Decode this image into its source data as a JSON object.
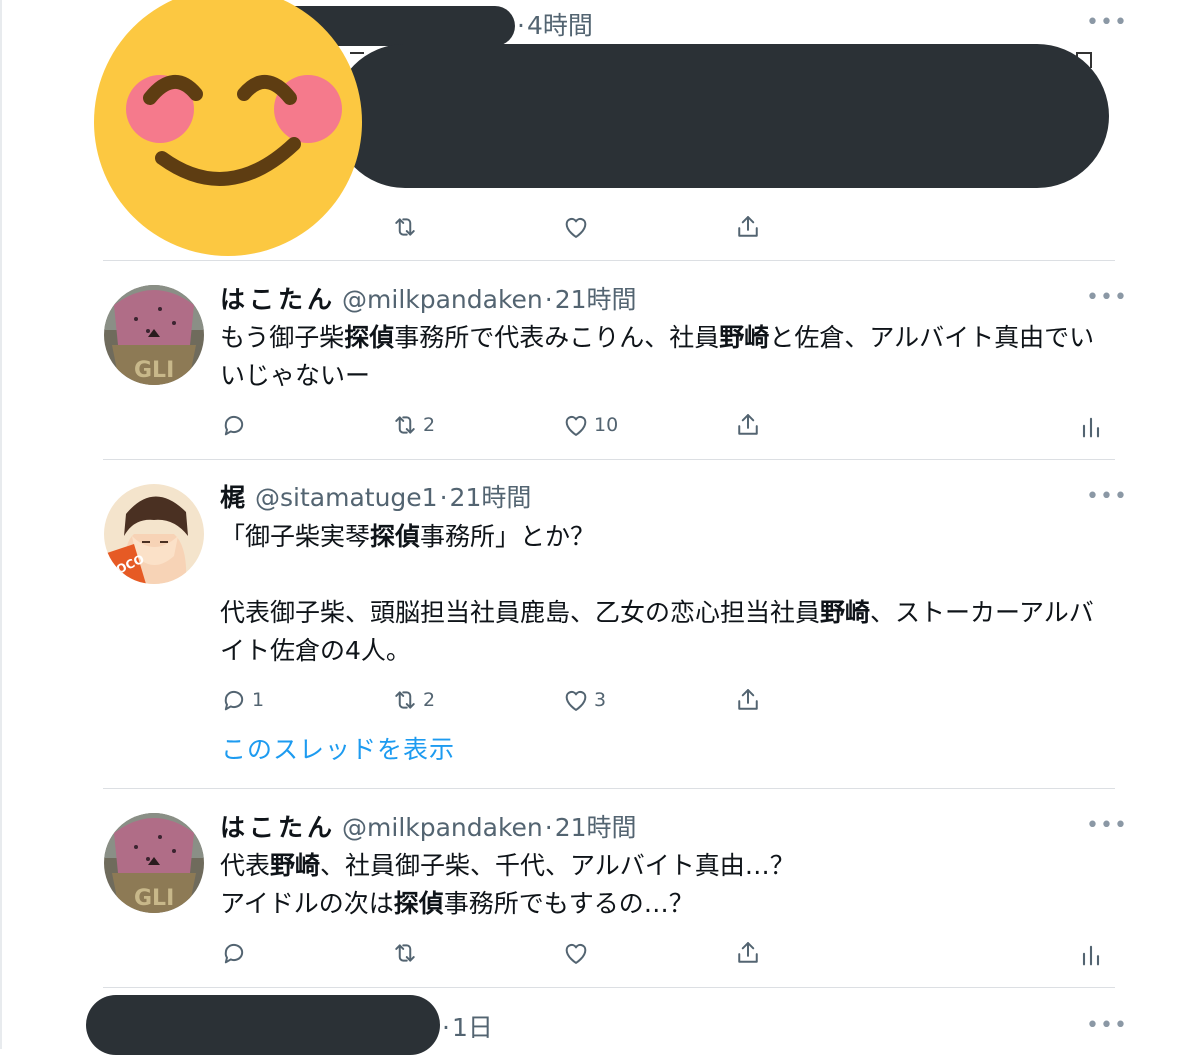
{
  "tweets": [
    {
      "time": "4時間",
      "counts": {
        "reply": "",
        "retweet": "",
        "like": ""
      }
    },
    {
      "name": "はこたん",
      "handle": "@milkpandaken",
      "time": "21時間",
      "body": [
        {
          "t": "もう御子柴"
        },
        {
          "t": "探偵",
          "b": true
        },
        {
          "t": "事務所で代表みこりん、社員"
        },
        {
          "t": "野崎",
          "b": true
        },
        {
          "t": "と佐倉、アルバイト真由でいいじゃないー"
        }
      ],
      "counts": {
        "reply": "",
        "retweet": "2",
        "like": "10"
      }
    },
    {
      "name": "梶",
      "handle": "@sitamatuge1",
      "time": "21時間",
      "body": [
        {
          "t": "「御子柴実琴"
        },
        {
          "t": "探偵",
          "b": true
        },
        {
          "t": "事務所」とか？\n\n代表御子柴、頭脳担当社員鹿島、乙女の恋心担当社員"
        },
        {
          "t": "野崎",
          "b": true
        },
        {
          "t": "、ストーカーアルバイト佐倉の4人。"
        }
      ],
      "counts": {
        "reply": "1",
        "retweet": "2",
        "like": "3"
      },
      "thread_link": "このスレッドを表示"
    },
    {
      "name": "はこたん",
      "handle": "@milkpandaken",
      "time": "21時間",
      "body": [
        {
          "t": "代表"
        },
        {
          "t": "野崎",
          "b": true
        },
        {
          "t": "、社員御子柴、千代、アルバイト真由…？\nアイドルの次は"
        },
        {
          "t": "探偵",
          "b": true
        },
        {
          "t": "事務所でもするの…？"
        }
      ],
      "counts": {
        "reply": "",
        "retweet": "",
        "like": ""
      }
    },
    {
      "time": "1日"
    }
  ],
  "icons": {
    "reply": "reply-icon",
    "retweet": "retweet-icon",
    "like": "heart-icon",
    "share": "share-icon",
    "analytics": "analytics-icon",
    "more": "more-icon",
    "emoji_sticker": "smiling-face-emoji"
  },
  "ui": {
    "more_glyph": "•••",
    "separator": "·"
  },
  "colors": {
    "link": "#1d9bf0",
    "muted": "#536471",
    "redaction": "#2b3136",
    "emoji_face": "#fcc841",
    "emoji_blush": "#f57a8c"
  }
}
